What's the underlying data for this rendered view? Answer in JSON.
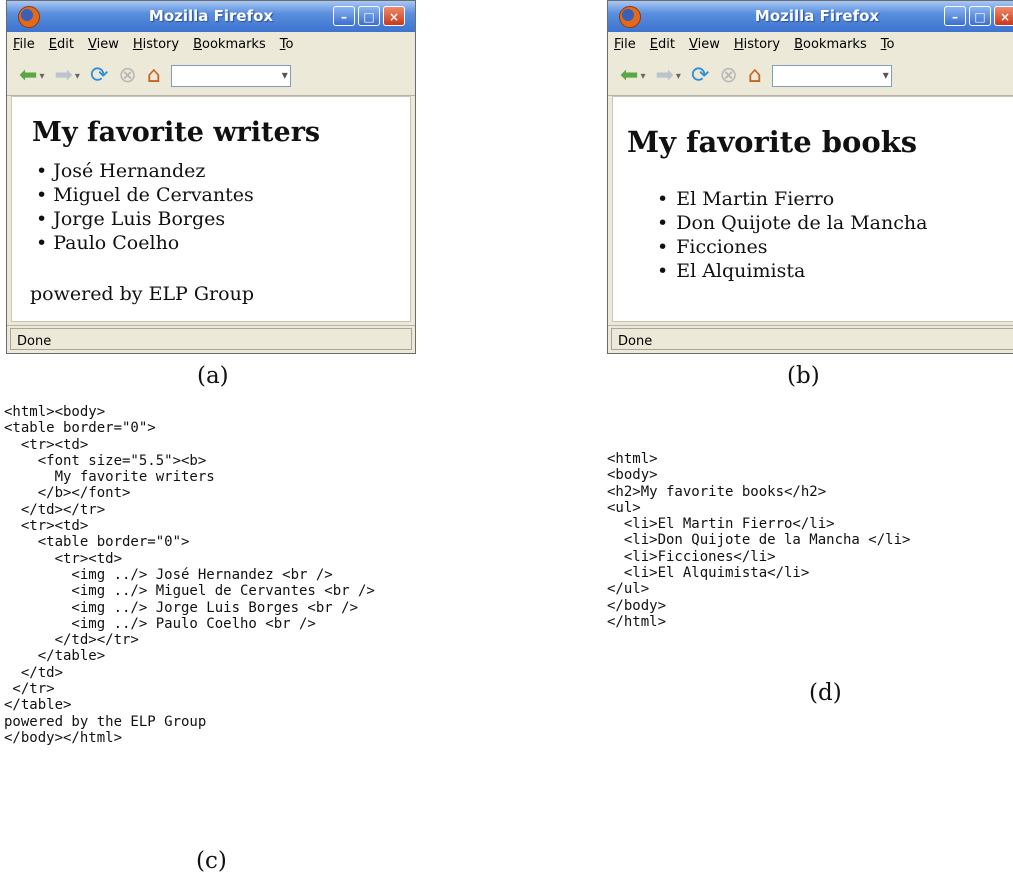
{
  "window_a": {
    "title": "Mozilla Firefox",
    "menu": [
      "File",
      "Edit",
      "View",
      "History",
      "Bookmarks",
      "To"
    ],
    "heading": "My favorite writers",
    "items": [
      "José Hernandez",
      "Miguel de Cervantes",
      "Jorge Luis Borges",
      "Paulo Coelho"
    ],
    "footer": "powered by ELP Group",
    "status": "Done"
  },
  "window_b": {
    "title": "Mozilla Firefox",
    "menu": [
      "File",
      "Edit",
      "View",
      "History",
      "Bookmarks",
      "To"
    ],
    "heading": "My favorite books",
    "items": [
      "El Martin Fierro",
      "Don Quijote de la Mancha",
      "Ficciones",
      "El Alquimista"
    ],
    "status": "Done"
  },
  "captions": {
    "a": "(a)",
    "b": "(b)",
    "c": "(c)",
    "d": "(d)"
  },
  "code_c": "<html><body>\n<table border=\"0\">\n  <tr><td>\n    <font size=\"5.5\"><b>\n      My favorite writers\n    </b></font>\n  </td></tr>\n  <tr><td>\n    <table border=\"0\">\n      <tr><td>\n        <img ../> José Hernandez <br />\n        <img ../> Miguel de Cervantes <br />\n        <img ../> Jorge Luis Borges <br />\n        <img ../> Paulo Coelho <br />\n      </td></tr>\n    </table>\n  </td>\n </tr>\n</table>\npowered by the ELP Group\n</body></html>",
  "code_d": "<html>\n<body>\n<h2>My favorite books</h2>\n<ul>\n  <li>El Martin Fierro</li>\n  <li>Don Quijote de la Mancha </li>\n  <li>Ficciones</li>\n  <li>El Alquimista</li>\n</ul>\n</body>\n</html>",
  "icons": {
    "back": "back-arrow-icon",
    "forward": "forward-arrow-icon",
    "reload": "reload-icon",
    "stop": "stop-icon",
    "home": "home-icon"
  }
}
